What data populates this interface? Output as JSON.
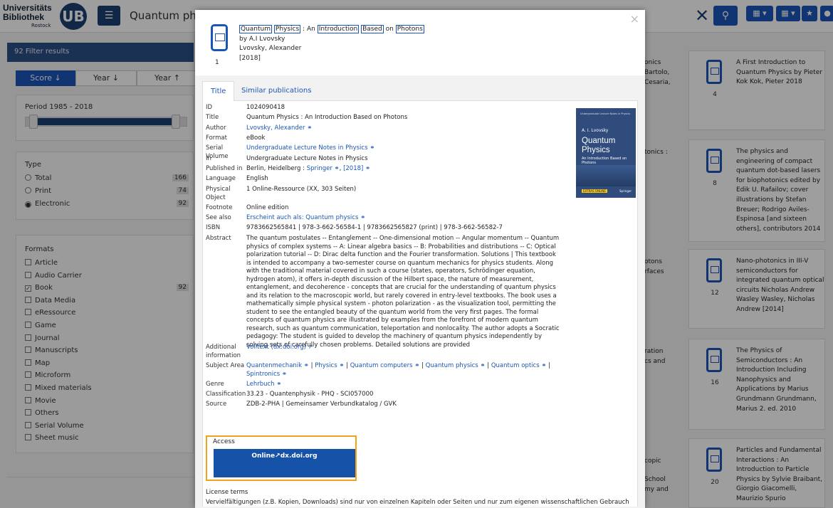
{
  "header": {
    "logo_line1": "Universitäts",
    "logo_line2": "Bibliothek",
    "logo_city": "Rostock",
    "logo_mark": "UB",
    "search_query": "Quantum phys",
    "filter_icon": "sliders-icon",
    "clear_icon": "x-icon",
    "search_icon": "search-icon",
    "lang_icon": "flag-uk-icon",
    "grid_icon": "grid-icon",
    "star_icon": "star-icon",
    "user_icon": "user-icon"
  },
  "sidebar": {
    "filter_results": "92 Filter results",
    "sort": [
      "Score",
      "Year",
      "Year"
    ],
    "period_label": "Period 1985 - 2018",
    "type_heading": "Type",
    "types": [
      {
        "label": "Total",
        "count": "166",
        "selected": false
      },
      {
        "label": "Print",
        "count": "74",
        "selected": false
      },
      {
        "label": "Electronic",
        "count": "92",
        "selected": true
      }
    ],
    "formats_heading": "Formats",
    "formats": [
      {
        "label": "Article",
        "count": "",
        "checked": false
      },
      {
        "label": "Audio Carrier",
        "count": "",
        "checked": false
      },
      {
        "label": "Book",
        "count": "92",
        "checked": true
      },
      {
        "label": "Data Media",
        "count": "",
        "checked": false
      },
      {
        "label": "eRessource",
        "count": "",
        "checked": false
      },
      {
        "label": "Game",
        "count": "",
        "checked": false
      },
      {
        "label": "Journal",
        "count": "",
        "checked": false
      },
      {
        "label": "Manuscripts",
        "count": "",
        "checked": false
      },
      {
        "label": "Map",
        "count": "",
        "checked": false
      },
      {
        "label": "Microform",
        "count": "",
        "checked": false
      },
      {
        "label": "Mixed materials",
        "count": "",
        "checked": false
      },
      {
        "label": "Movie",
        "count": "",
        "checked": false
      },
      {
        "label": "Others",
        "count": "",
        "checked": false
      },
      {
        "label": "Serial Volume",
        "count": "",
        "checked": false
      },
      {
        "label": "Sheet music",
        "count": "",
        "checked": false
      }
    ]
  },
  "results": {
    "cards": [
      {
        "num": "4",
        "text": "A First Introduction to Quantum Physics by Pieter Kok Kok, Pieter 2018"
      },
      {
        "num": "8",
        "text": "The physics and engineering of compact quantum dot-based lasers for biophotonics edited by Edik U. Rafailov; cover illustrations by Stefan Breuer; Rodrigo Aviles-Espinosa [and sixteen others], contributors 2014"
      },
      {
        "num": "12",
        "text": "Nano-photonics in III-V semiconductors for integrated quantum optical circuits Nicholas Andrew Wasley Wasley, Nicholas Andrew [2014]"
      },
      {
        "num": "16",
        "text": "The Physics of Semiconductors : An Introduction Including Nanophysics and Applications by Marius Grundmann Grundmann, Marius 2. ed. 2010"
      },
      {
        "num": "20",
        "text": "Particles and Fundamental Interactions : An Introduction to Particle Physics by Sylvie Braibant, Giorgio Giacomelli, Maurizio Spurio"
      }
    ],
    "fragments": [
      "onics",
      "Bartolo,",
      "Cesaria,",
      "tonics :",
      "otons",
      "rfaces",
      "ration",
      "cs and",
      "copic",
      "School",
      "my and"
    ]
  },
  "modal": {
    "close_icon": "close-icon",
    "index": "1",
    "title_words": [
      "Quantum",
      "Physics",
      "An",
      "Introduction",
      "Based",
      "on",
      "Photons"
    ],
    "by_line": "by A.I Lvovsky",
    "author_line": "Lvovsky, Alexander",
    "year_line": "[2018]",
    "tab_title": "Title",
    "tab_similar": "Similar publications",
    "fields": {
      "id_k": "ID",
      "id_v": "1024090418",
      "title_k": "Title",
      "title_v": "Quantum Physics : An Introduction Based on Photons",
      "author_k": "Author",
      "author_v": "Lvovsky, Alexander",
      "format_k": "Format",
      "format_v": "eBook",
      "serial_k": "Serial Volume",
      "serial_v": "Undergraduate Lecture Notes in Physics",
      "in_k": "In",
      "in_v": "Undergraduate Lecture Notes in Physics",
      "pub_k": "Published in",
      "pub_v1": "Berlin, Heidelberg : ",
      "pub_v2": "Springer",
      "pub_v3": "[2018]",
      "lang_k": "Language",
      "lang_v": "English",
      "phys_k1": "Physical",
      "phys_k2": "Object",
      "phys_v": "1 Online-Ressource (XX, 303 Seiten)",
      "foot_k": "Footnote",
      "foot_v": "Online edition",
      "see_k": "See also",
      "see_v": "Erscheint auch als: Quantum physics",
      "isbn_k": "ISBN",
      "isbn_v": "9783662565841 | 978-3-662-56584-1 | 9783662565827 (print) | 978-3-662-56582-7",
      "abs_k": "Abstract",
      "abs_v": "The quantum postulates -- Entanglement -- One-dimensional motion -- Angular momentum -- Quantum physics of complex systems -- A: Linear algebra basics -- B: Probabilities and distributions -- C: Optical polarization tutorial -- D: Dirac delta function and the Fourier transformation. Solutions | This textbook is intended to accompany a two-semester course on quantum mechanics for physics students. Along with the traditional material covered in such a course (states, operators, Schrödinger equation, hydrogen atom), it offers in-depth discussion of the Hilbert space, the nature of measurement, entanglement, and decoherence - concepts that are crucial for the understanding of quantum physics and its relation to the macroscopic world, but rarely covered in entry-level textbooks. The book uses a mathematically simple physical system - photon polarization - as the visualization tool, permitting the student to see the entangled beauty of the quantum world from the very first pages. The formal concepts of quantum physics are illustrated by examples from the forefront of modern quantum research, such as quantum communication, teleportation and nonlocality. The author adopts a Socratic pedagogy: The student is guided to develop the machinery of quantum physics independently by solving sets of carefully chosen problems. Detailed solutions are provided",
      "add_k1": "Additional",
      "add_k2": "information",
      "add_v": "Volltext (dx.doi.org)",
      "subj_k": "Subject Area",
      "subjects": [
        "Quantenmechanik",
        "Physics",
        "Quantum computers",
        "Quantum physics",
        "Quantum optics",
        "Spintronics"
      ],
      "genre_k": "Genre",
      "genre_v": "Lehrbuch",
      "class_k": "Classification",
      "class_v": "33.23 - Quantenphysik - PHQ - SCI057000",
      "src_k": "Source",
      "src_v": "ZDB-2-PHA | Gemeinsamer Verbundkatalog / GVK"
    },
    "cover": {
      "series": "Undergraduate Lecture Notes in Physics",
      "author": "A. I. Lvovsky",
      "title1": "Quantum",
      "title2": "Physics",
      "subtitle": "An Introduction Based on Photons",
      "badge": "EXTRAS ONLINE",
      "publisher": "Springer"
    },
    "access_label": "Access",
    "access_button": "Online",
    "access_button_domain": "dx.doi.org",
    "license_heading": "License terms",
    "license_text": "Vervielfältigungen (z.B. Kopien, Downloads) sind nur von einzelnen Kapiteln oder Seiten und nur zum eigenen wissenschaftlichen Gebrauch erlaubt. Keine Weitergabe an Dritte. Kein systematisches Downloaden durch Robots."
  },
  "colors": {
    "primary": "#1a56b8",
    "dark_blue": "#1c3f72",
    "access_highlight": "#f0a41c",
    "panel_bg": "#f2f2f2"
  }
}
